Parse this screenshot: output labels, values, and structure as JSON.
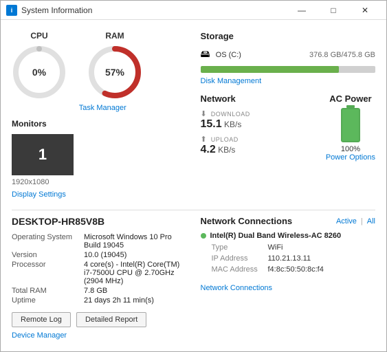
{
  "window": {
    "title": "System Information",
    "controls": {
      "minimize": "—",
      "maximize": "□",
      "close": "✕"
    }
  },
  "cpu": {
    "label": "CPU",
    "value": "0%",
    "percent": 0
  },
  "ram": {
    "label": "RAM",
    "value": "57%",
    "percent": 57
  },
  "task_manager_link": "Task Manager",
  "monitors": {
    "title": "Monitors",
    "count": "1",
    "resolution": "1920x1080",
    "display_settings_link": "Display Settings"
  },
  "storage": {
    "title": "Storage",
    "label": "OS (C:)",
    "icon": "🖴",
    "size_text": "376.8 GB/475.8 GB",
    "fill_percent": 79,
    "disk_management_link": "Disk Management"
  },
  "network": {
    "title": "Network",
    "download_label": "DOWNLOAD",
    "download_value": "15.1",
    "download_unit": "KB/s",
    "upload_label": "UPLOAD",
    "upload_value": "4.2",
    "upload_unit": "KB/s"
  },
  "ac_power": {
    "title": "AC Power",
    "percent": "100%",
    "power_options_link": "Power Options"
  },
  "system_info": {
    "title": "DESKTOP-HR85V8B",
    "rows": [
      {
        "key": "Operating System",
        "value": "Microsoft Windows 10 Pro Build 19045"
      },
      {
        "key": "Version",
        "value": "10.0 (19045)"
      },
      {
        "key": "Processor",
        "value": "4 core(s) - Intel(R) Core(TM) i7-7500U CPU @ 2.70GHz (2904 MHz)"
      },
      {
        "key": "Total RAM",
        "value": "7.8 GB"
      },
      {
        "key": "Uptime",
        "value": "21 days 2h 11 min(s)"
      }
    ],
    "remote_log_btn": "Remote Log",
    "detailed_report_btn": "Detailed Report",
    "device_manager_link": "Device Manager"
  },
  "network_connections": {
    "title": "Network Connections",
    "filter_active": "Active",
    "filter_sep": "|",
    "filter_all": "All",
    "connection": {
      "name": "Intel(R) Dual Band Wireless-AC 8260",
      "type_label": "Type",
      "type_value": "WiFi",
      "ip_label": "IP Address",
      "ip_value": "110.21.13.11",
      "mac_label": "MAC Address",
      "mac_value": "f4:8c:50:50:8c:f4"
    },
    "link": "Network Connections"
  }
}
